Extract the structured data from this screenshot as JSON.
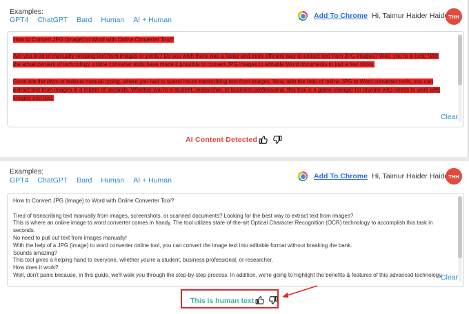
{
  "top_panel": {
    "examples_label": "Examples:",
    "example_links": [
      "GPT4",
      "ChatGPT",
      "Bard",
      "Human",
      "AI + Human"
    ],
    "add_to_chrome": "Add To Chrome",
    "greeting": "Hi, Taimur Haider Haider",
    "avatar_initials": "THH",
    "paragraphs": [
      "How to Convert JPG (Image) to Word with Online Converter Tool?",
      "Are you tired of manually retyping text from images or prints? Do you wish there was a faster and more efficient way to extract text from JPG images? Well, you're in luck! With the advancement of technology, online converter tools have made it possible to convert JPG images to editable Word documents in just a few clicks.",
      "Gone are the days of tedious manual typing, where you had to spend hours transcribing text from images. Now, with the help of online JPG to Word converter tools, you can extract text from images in a matter of seconds. Whether you're a student, researcher, or business professional, this tool is a game-changer for anyone who needs to work with images and text."
    ],
    "clear_label": "Clear",
    "result_label": "AI Content Detected",
    "highlight_color": "#f21d1d",
    "result_color": "#e4413a"
  },
  "bottom_panel": {
    "examples_label": "Examples:",
    "example_links": [
      "GPT4",
      "ChatGPT",
      "Bard",
      "Human",
      "AI + Human"
    ],
    "add_to_chrome": "Add To Chrome",
    "greeting": "Hi, Taimur Haider Haider",
    "avatar_initials": "THH",
    "lines": [
      "How to Convert JPG (Image) to Word with Online Converter Tool?",
      "Tired of transcribing text manually from images, screenshots, or scanned documents? Looking for the best way to extract text from images?",
      "This is where an online image to word converter comes in handy. The tool utilizes state-of-the-art Optical Character Recognition (OCR) technology to accomplish this task in seconds.",
      "No need to pull out text from images manually!",
      "With the help of a JPG (image) to word converter online tool, you can convert the image text into editable format without breaking the bank.",
      "Sounds amazing?",
      "This tool gives a helping hand to everyone, whether you're a student, business professional, or researcher.",
      "How does it work?",
      "Well, don't panic because, in this guide, we'll walk you through the step-by-step process. In addition, we're going to highlight the benefits & features of this advanced technology."
    ],
    "clear_label": "Clear",
    "result_label": "This is human text",
    "result_color": "#3bb39a",
    "annotation_color": "#e02828"
  }
}
